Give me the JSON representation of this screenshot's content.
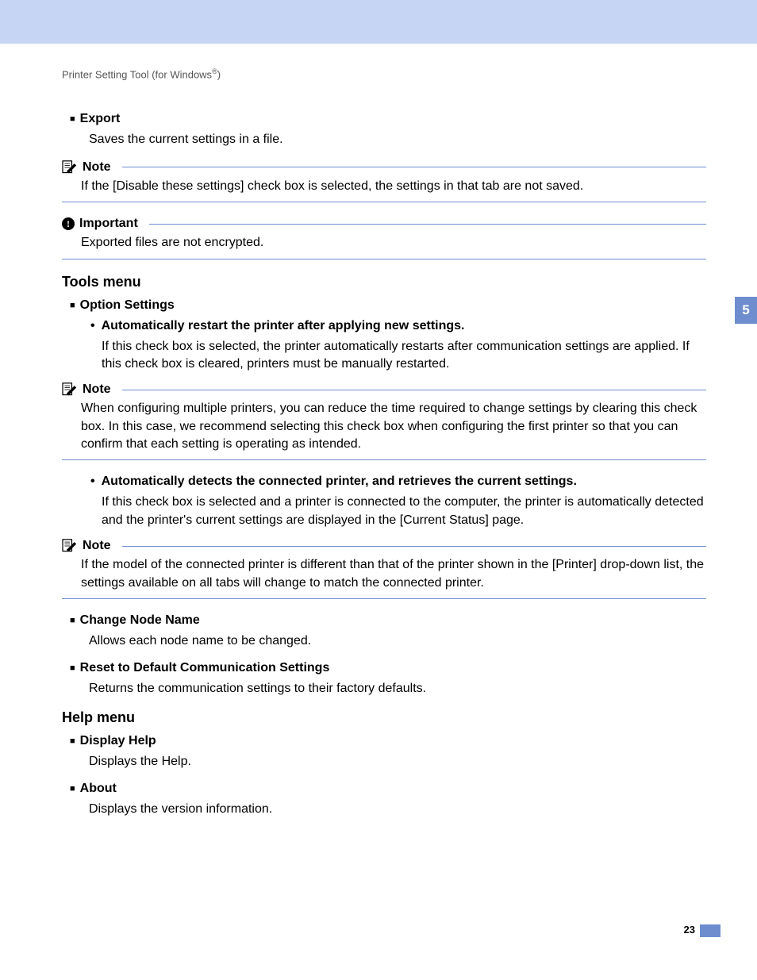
{
  "header": {
    "title_prefix": "Printer Setting Tool (for Windows",
    "title_suffix": ")",
    "superscript": "®"
  },
  "side_tab": "5",
  "page_number": "23",
  "export": {
    "title": "Export",
    "body": "Saves the current settings in a file."
  },
  "note1": {
    "label": "Note",
    "body": "If the [Disable these settings] check box is selected, the settings in that tab are not saved."
  },
  "important1": {
    "label": "Important",
    "body": "Exported files are not encrypted."
  },
  "tools_heading": "Tools menu",
  "option_settings": {
    "title": "Option Settings",
    "sub1_title": "Automatically restart the printer after applying new settings.",
    "sub1_body": "If this check box is selected, the printer automatically restarts after communication settings are applied. If this check box is cleared, printers must be manually restarted.",
    "sub2_title": "Automatically detects the connected printer, and retrieves the current settings.",
    "sub2_body": "If this check box is selected and a printer is connected to the computer, the printer is automatically detected and the printer's current settings are displayed in the [Current Status] page."
  },
  "note2": {
    "label": "Note",
    "body": "When configuring multiple printers, you can reduce the time required to change settings by clearing this check box. In this case, we recommend selecting this check box when configuring the first printer so that you can confirm that each setting is operating as intended."
  },
  "note3": {
    "label": "Note",
    "body": "If the model of the connected printer is different than that of the printer shown in the [Printer] drop-down list, the settings available on all tabs will change to match the connected printer."
  },
  "change_node": {
    "title": "Change Node Name",
    "body": "Allows each node name to be changed."
  },
  "reset_default": {
    "title": "Reset to Default Communication Settings",
    "body": "Returns the communication settings to their factory defaults."
  },
  "help_heading": "Help menu",
  "display_help": {
    "title": "Display Help",
    "body": "Displays the Help."
  },
  "about": {
    "title": "About",
    "body": "Displays the version information."
  }
}
